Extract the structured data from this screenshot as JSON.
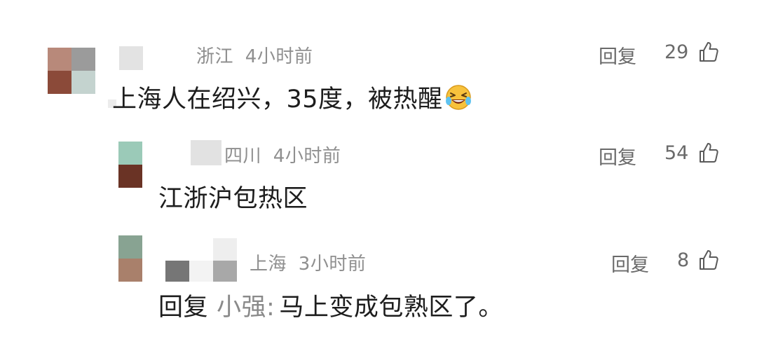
{
  "comments": [
    {
      "location": "浙江",
      "time": "4小时前",
      "reply_label": "回复",
      "likes": "29",
      "text": "上海人在绍兴，35度，被热醒",
      "emoji": "grinning-squinting-tears-emoji",
      "avatar_colors": [
        "#b8897a",
        "#9b9b9b",
        "#8b4a39",
        "#c4d3cf"
      ]
    },
    {
      "location": "四川",
      "time": "4小时前",
      "reply_label": "回复",
      "likes": "54",
      "text": "江浙沪包热区",
      "avatar_colors": [
        "#9bcab8",
        "#6a3325"
      ]
    },
    {
      "location": "上海",
      "time": "3小时前",
      "reply_label": "回复",
      "likes": "8",
      "text_prefix": "回复",
      "reply_target": "小强",
      "reply_colon": ":",
      "text": "马上变成包熟区了。",
      "avatar_colors": [
        "#88a392",
        "#a9806b"
      ]
    }
  ],
  "colors": {
    "meta_text": "#8f8f8f",
    "body_text": "#1d1d1d",
    "action_text": "#6a6a6a"
  },
  "icons": {
    "like": "thumbs-up-icon"
  }
}
